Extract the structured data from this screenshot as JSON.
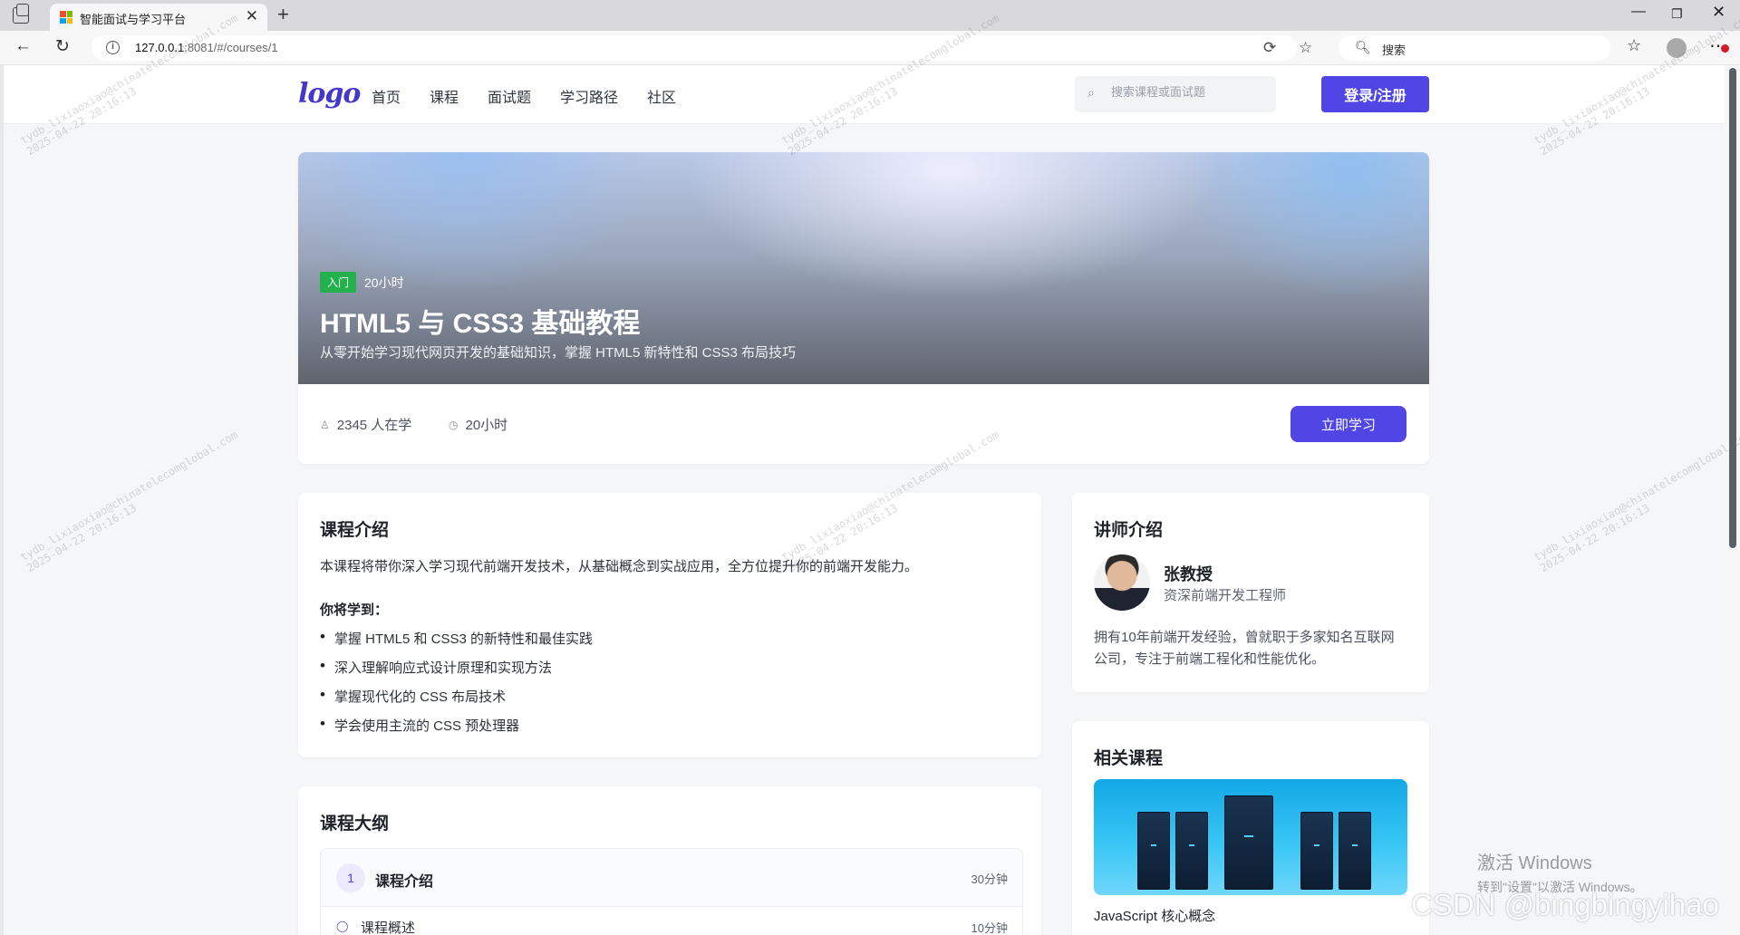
{
  "browser": {
    "tab_title": "智能面试与学习平台",
    "url_host": "127.0.0.1",
    "url_rest": ":8081/#/courses/1",
    "search_placeholder": "搜索"
  },
  "header": {
    "logo_text": "logo",
    "nav": [
      "首页",
      "课程",
      "面试题",
      "学习路径",
      "社区"
    ],
    "search_placeholder": "搜索课程或面试题",
    "login_label": "登录/注册"
  },
  "hero": {
    "level": "入门",
    "hours": "20小时",
    "title": "HTML5 与 CSS3 基础教程",
    "subtitle": "从零开始学习现代网页开发的基础知识，掌握 HTML5 新特性和 CSS3 布局技巧",
    "students": "2345 人在学",
    "duration": "20小时",
    "study_label": "立即学习"
  },
  "intro": {
    "heading": "课程介绍",
    "paragraph": "本课程将带你深入学习现代前端开发技术，从基础概念到实战应用，全方位提升你的前端开发能力。",
    "learn_heading": "你将学到：",
    "points": [
      "掌握 HTML5 和 CSS3 的新特性和最佳实践",
      "深入理解响应式设计原理和实现方法",
      "掌握现代化的 CSS 布局技术",
      "学会使用主流的 CSS 预处理器"
    ]
  },
  "outline": {
    "heading": "课程大纲",
    "items": [
      {
        "num": "1",
        "title": "课程介绍",
        "duration": "30分钟",
        "sub_title": "课程概述",
        "sub_duration": "10分钟"
      }
    ]
  },
  "teacher": {
    "heading": "讲师介绍",
    "name": "张教授",
    "title": "资深前端开发工程师",
    "bio": "拥有10年前端开发经验，曾就职于多家知名互联网公司，专注于前端工程化和性能优化。"
  },
  "related": {
    "heading": "相关课程",
    "items": [
      {
        "title": "JavaScript 核心概念"
      }
    ]
  },
  "overlay": {
    "activate_line1": "激活 Windows",
    "activate_line2": "转到\"设置\"以激活 Windows。",
    "watermark_line1": "tydb_lixiaoxiao@chinatelecomglobal.com",
    "watermark_line2": "2025-04-22 20:16:13",
    "csdn": "CSDN @bingbingyihao"
  },
  "colors": {
    "primary": "#4f46e5",
    "level_tag": "#22b14c"
  }
}
